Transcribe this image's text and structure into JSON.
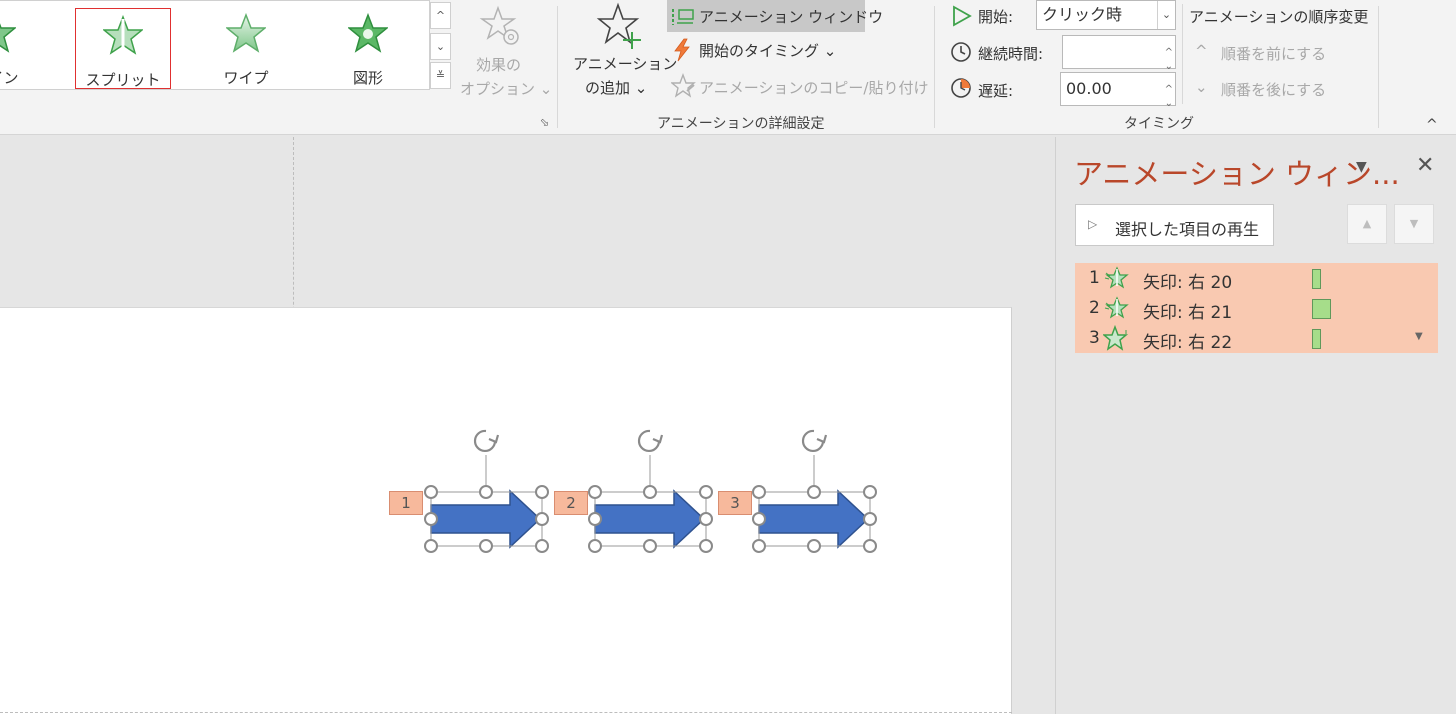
{
  "gallery": {
    "items": [
      {
        "label": "トイン"
      },
      {
        "label": "スプリット"
      },
      {
        "label": "ワイプ"
      },
      {
        "label": "図形"
      }
    ]
  },
  "effect_options": {
    "line1": "効果の",
    "line2": "オプション ⌄"
  },
  "add_animation": {
    "line1": "アニメーション",
    "line2": "の追加 ⌄"
  },
  "advanced": {
    "pane_button": "アニメーション ウィンドウ",
    "trigger": "開始のタイミング ⌄",
    "painter": "アニメーションのコピー/貼り付け",
    "group_label": "アニメーションの詳細設定"
  },
  "timing": {
    "start_label": "開始:",
    "start_value": "クリック時",
    "duration_label": "継続時間:",
    "duration_value": "",
    "delay_label": "遅延:",
    "delay_value": "00.00",
    "group_label": "タイミング"
  },
  "reorder": {
    "title": "アニメーションの順序変更",
    "earlier": "順番を前にする",
    "later": "順番を後にする"
  },
  "slide": {
    "tags": [
      "1",
      "2",
      "3"
    ]
  },
  "pane": {
    "title": "アニメーション ウィン...",
    "play_button": "選択した項目の再生",
    "items": [
      {
        "num": "1",
        "name": "矢印: 右 20"
      },
      {
        "num": "2",
        "name": "矢印: 右 21"
      },
      {
        "num": "3",
        "name": "矢印: 右 22"
      }
    ]
  },
  "colors": {
    "accent_title": "#b9472a",
    "selected_row": "#f9c9b1",
    "timeline_bar": "#a6dd8a",
    "arrow_fill": "#4472c4",
    "star_green": "#3fa24b"
  }
}
